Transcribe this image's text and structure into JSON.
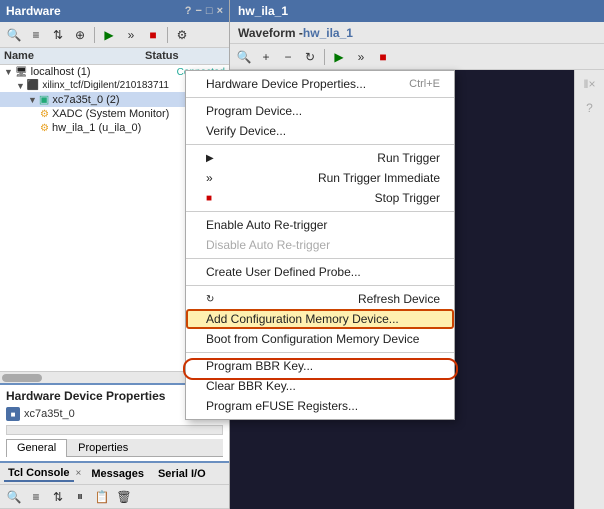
{
  "leftPanel": {
    "title": "Hardware",
    "titleControls": [
      "?",
      "−",
      "□",
      "×"
    ],
    "toolbar": {
      "buttons": [
        "search",
        "sort-az",
        "sort-za",
        "link",
        "play",
        "fast-forward",
        "stop",
        "settings"
      ]
    },
    "treeHeader": {
      "nameCol": "Name",
      "statusCol": "Status"
    },
    "treeItems": [
      {
        "indent": 0,
        "label": "localhost (1)",
        "status": "Connected",
        "type": "host",
        "expanded": true
      },
      {
        "indent": 1,
        "label": "xilinx_tcf/Digilent/210183711",
        "status": "",
        "type": "cable",
        "expanded": true
      },
      {
        "indent": 2,
        "label": "xc7a35t_0 (2)",
        "status": "",
        "type": "device",
        "expanded": true,
        "selected": true
      },
      {
        "indent": 3,
        "label": "XADC (System Monitor)",
        "status": "",
        "type": "monitor"
      },
      {
        "indent": 3,
        "label": "hw_ila_1 (u_ila_0)",
        "status": "",
        "type": "ila"
      }
    ]
  },
  "hwProps": {
    "sectionTitle": "Hardware Device Properties",
    "deviceName": "xc7a35t_0",
    "tabs": [
      "General",
      "Properties"
    ]
  },
  "tclConsole": {
    "tabs": [
      "Tcl Console",
      "Messages",
      "Serial I/O"
    ],
    "toolbar": [
      "search",
      "sort",
      "sort2",
      "pause",
      "copy",
      "clear"
    ]
  },
  "rightPanel": {
    "title": "hw_ila_1",
    "waveformLabel": "Waveform - ",
    "waveformName": "hw_ila_1",
    "toolbar": [
      "search",
      "plus",
      "minus",
      "redo",
      "play",
      "fast-forward",
      "stop"
    ]
  },
  "contextMenu": {
    "items": [
      {
        "label": "Hardware Device Properties...",
        "shortcut": "Ctrl+E",
        "type": "normal"
      },
      {
        "separator": true
      },
      {
        "label": "Program Device...",
        "type": "normal"
      },
      {
        "label": "Verify Device...",
        "type": "normal"
      },
      {
        "separator": true
      },
      {
        "label": "Run Trigger",
        "type": "arrow",
        "icon": "▶"
      },
      {
        "label": "Run Trigger Immediate",
        "type": "arrow2",
        "icon": "»"
      },
      {
        "label": "Stop Trigger",
        "type": "stop",
        "icon": "■"
      },
      {
        "separator": true
      },
      {
        "label": "Enable Auto Re-trigger",
        "type": "normal"
      },
      {
        "label": "Disable Auto Re-trigger",
        "type": "disabled"
      },
      {
        "separator": true
      },
      {
        "label": "Create User Defined Probe...",
        "type": "normal"
      },
      {
        "separator": true
      },
      {
        "label": "Refresh Device",
        "type": "refresh",
        "icon": "↻"
      },
      {
        "label": "Add Configuration Memory Device...",
        "type": "highlighted"
      },
      {
        "label": "Boot from Configuration Memory Device",
        "type": "normal"
      },
      {
        "separator": true
      },
      {
        "label": "Program BBR Key...",
        "type": "normal"
      },
      {
        "label": "Clear BBR Key...",
        "type": "normal"
      },
      {
        "label": "Program eFUSE Registers...",
        "type": "normal"
      }
    ]
  }
}
